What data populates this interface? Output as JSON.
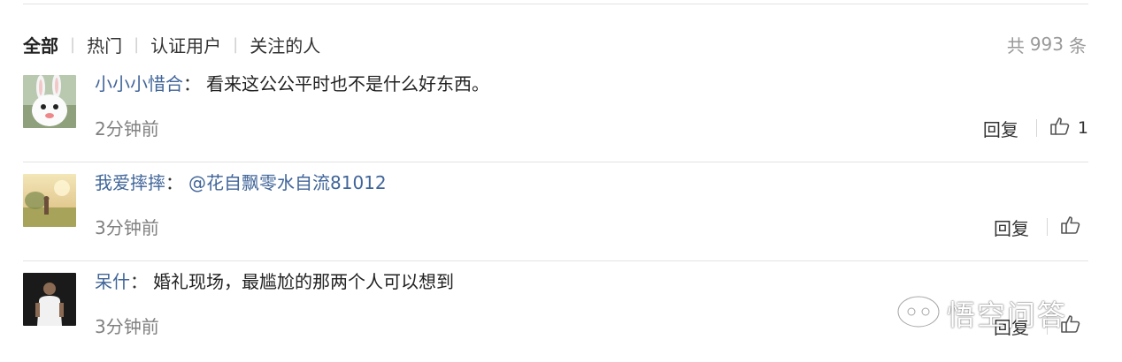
{
  "filters": {
    "tabs": [
      {
        "label": "全部",
        "active": true
      },
      {
        "label": "热门",
        "active": false
      },
      {
        "label": "认证用户",
        "active": false
      },
      {
        "label": "关注的人",
        "active": false
      }
    ]
  },
  "total": {
    "prefix": "共",
    "count": "993",
    "suffix": "条"
  },
  "comments": [
    {
      "user": "小小小惜合",
      "colon": "：",
      "text": "看来这公公平时也不是什么好东西。",
      "time": "2分钟前",
      "reply_label": "回复",
      "likes": "1",
      "avatar_icon": "white-rabbit-avatar"
    },
    {
      "user": "我爱摔摔",
      "colon": "：",
      "text": "@花自飘零水自流81012",
      "time": "3分钟前",
      "reply_label": "回复",
      "likes": "",
      "avatar_icon": "sunset-field-avatar"
    },
    {
      "user": "呆什",
      "colon": "：",
      "text": "婚礼现场，最尴尬的那两个人可以想到",
      "time": "3分钟前",
      "reply_label": "回复",
      "likes": "",
      "avatar_icon": "person-photo-avatar"
    }
  ],
  "watermark": {
    "text": "悟空问答",
    "icon": "wukong-logo-icon"
  },
  "colors": {
    "link": "#406599",
    "muted": "#808080",
    "divider": "#e3e3e3"
  }
}
